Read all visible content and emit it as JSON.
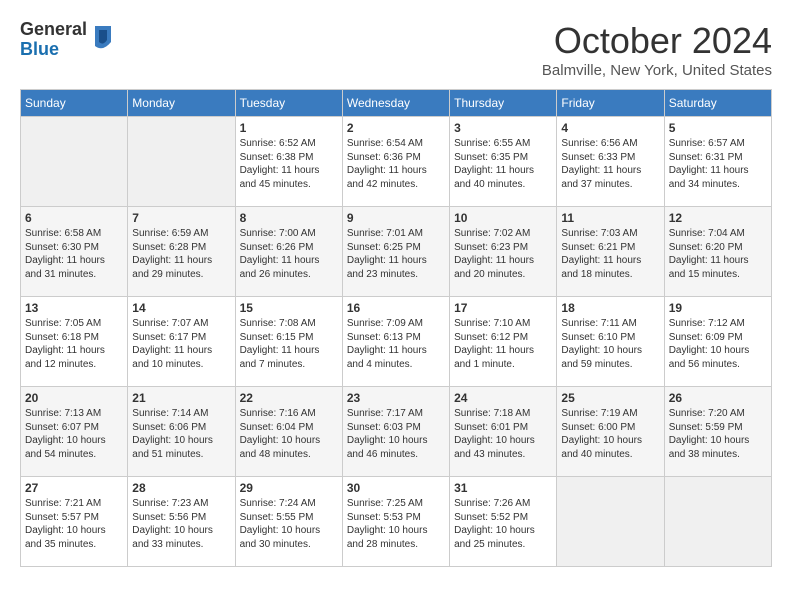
{
  "header": {
    "logo_general": "General",
    "logo_blue": "Blue",
    "month_title": "October 2024",
    "location": "Balmville, New York, United States"
  },
  "days_of_week": [
    "Sunday",
    "Monday",
    "Tuesday",
    "Wednesday",
    "Thursday",
    "Friday",
    "Saturday"
  ],
  "weeks": [
    [
      {
        "day": "",
        "sunrise": "",
        "sunset": "",
        "daylight": ""
      },
      {
        "day": "",
        "sunrise": "",
        "sunset": "",
        "daylight": ""
      },
      {
        "day": "1",
        "sunrise": "Sunrise: 6:52 AM",
        "sunset": "Sunset: 6:38 PM",
        "daylight": "Daylight: 11 hours and 45 minutes."
      },
      {
        "day": "2",
        "sunrise": "Sunrise: 6:54 AM",
        "sunset": "Sunset: 6:36 PM",
        "daylight": "Daylight: 11 hours and 42 minutes."
      },
      {
        "day": "3",
        "sunrise": "Sunrise: 6:55 AM",
        "sunset": "Sunset: 6:35 PM",
        "daylight": "Daylight: 11 hours and 40 minutes."
      },
      {
        "day": "4",
        "sunrise": "Sunrise: 6:56 AM",
        "sunset": "Sunset: 6:33 PM",
        "daylight": "Daylight: 11 hours and 37 minutes."
      },
      {
        "day": "5",
        "sunrise": "Sunrise: 6:57 AM",
        "sunset": "Sunset: 6:31 PM",
        "daylight": "Daylight: 11 hours and 34 minutes."
      }
    ],
    [
      {
        "day": "6",
        "sunrise": "Sunrise: 6:58 AM",
        "sunset": "Sunset: 6:30 PM",
        "daylight": "Daylight: 11 hours and 31 minutes."
      },
      {
        "day": "7",
        "sunrise": "Sunrise: 6:59 AM",
        "sunset": "Sunset: 6:28 PM",
        "daylight": "Daylight: 11 hours and 29 minutes."
      },
      {
        "day": "8",
        "sunrise": "Sunrise: 7:00 AM",
        "sunset": "Sunset: 6:26 PM",
        "daylight": "Daylight: 11 hours and 26 minutes."
      },
      {
        "day": "9",
        "sunrise": "Sunrise: 7:01 AM",
        "sunset": "Sunset: 6:25 PM",
        "daylight": "Daylight: 11 hours and 23 minutes."
      },
      {
        "day": "10",
        "sunrise": "Sunrise: 7:02 AM",
        "sunset": "Sunset: 6:23 PM",
        "daylight": "Daylight: 11 hours and 20 minutes."
      },
      {
        "day": "11",
        "sunrise": "Sunrise: 7:03 AM",
        "sunset": "Sunset: 6:21 PM",
        "daylight": "Daylight: 11 hours and 18 minutes."
      },
      {
        "day": "12",
        "sunrise": "Sunrise: 7:04 AM",
        "sunset": "Sunset: 6:20 PM",
        "daylight": "Daylight: 11 hours and 15 minutes."
      }
    ],
    [
      {
        "day": "13",
        "sunrise": "Sunrise: 7:05 AM",
        "sunset": "Sunset: 6:18 PM",
        "daylight": "Daylight: 11 hours and 12 minutes."
      },
      {
        "day": "14",
        "sunrise": "Sunrise: 7:07 AM",
        "sunset": "Sunset: 6:17 PM",
        "daylight": "Daylight: 11 hours and 10 minutes."
      },
      {
        "day": "15",
        "sunrise": "Sunrise: 7:08 AM",
        "sunset": "Sunset: 6:15 PM",
        "daylight": "Daylight: 11 hours and 7 minutes."
      },
      {
        "day": "16",
        "sunrise": "Sunrise: 7:09 AM",
        "sunset": "Sunset: 6:13 PM",
        "daylight": "Daylight: 11 hours and 4 minutes."
      },
      {
        "day": "17",
        "sunrise": "Sunrise: 7:10 AM",
        "sunset": "Sunset: 6:12 PM",
        "daylight": "Daylight: 11 hours and 1 minute."
      },
      {
        "day": "18",
        "sunrise": "Sunrise: 7:11 AM",
        "sunset": "Sunset: 6:10 PM",
        "daylight": "Daylight: 10 hours and 59 minutes."
      },
      {
        "day": "19",
        "sunrise": "Sunrise: 7:12 AM",
        "sunset": "Sunset: 6:09 PM",
        "daylight": "Daylight: 10 hours and 56 minutes."
      }
    ],
    [
      {
        "day": "20",
        "sunrise": "Sunrise: 7:13 AM",
        "sunset": "Sunset: 6:07 PM",
        "daylight": "Daylight: 10 hours and 54 minutes."
      },
      {
        "day": "21",
        "sunrise": "Sunrise: 7:14 AM",
        "sunset": "Sunset: 6:06 PM",
        "daylight": "Daylight: 10 hours and 51 minutes."
      },
      {
        "day": "22",
        "sunrise": "Sunrise: 7:16 AM",
        "sunset": "Sunset: 6:04 PM",
        "daylight": "Daylight: 10 hours and 48 minutes."
      },
      {
        "day": "23",
        "sunrise": "Sunrise: 7:17 AM",
        "sunset": "Sunset: 6:03 PM",
        "daylight": "Daylight: 10 hours and 46 minutes."
      },
      {
        "day": "24",
        "sunrise": "Sunrise: 7:18 AM",
        "sunset": "Sunset: 6:01 PM",
        "daylight": "Daylight: 10 hours and 43 minutes."
      },
      {
        "day": "25",
        "sunrise": "Sunrise: 7:19 AM",
        "sunset": "Sunset: 6:00 PM",
        "daylight": "Daylight: 10 hours and 40 minutes."
      },
      {
        "day": "26",
        "sunrise": "Sunrise: 7:20 AM",
        "sunset": "Sunset: 5:59 PM",
        "daylight": "Daylight: 10 hours and 38 minutes."
      }
    ],
    [
      {
        "day": "27",
        "sunrise": "Sunrise: 7:21 AM",
        "sunset": "Sunset: 5:57 PM",
        "daylight": "Daylight: 10 hours and 35 minutes."
      },
      {
        "day": "28",
        "sunrise": "Sunrise: 7:23 AM",
        "sunset": "Sunset: 5:56 PM",
        "daylight": "Daylight: 10 hours and 33 minutes."
      },
      {
        "day": "29",
        "sunrise": "Sunrise: 7:24 AM",
        "sunset": "Sunset: 5:55 PM",
        "daylight": "Daylight: 10 hours and 30 minutes."
      },
      {
        "day": "30",
        "sunrise": "Sunrise: 7:25 AM",
        "sunset": "Sunset: 5:53 PM",
        "daylight": "Daylight: 10 hours and 28 minutes."
      },
      {
        "day": "31",
        "sunrise": "Sunrise: 7:26 AM",
        "sunset": "Sunset: 5:52 PM",
        "daylight": "Daylight: 10 hours and 25 minutes."
      },
      {
        "day": "",
        "sunrise": "",
        "sunset": "",
        "daylight": ""
      },
      {
        "day": "",
        "sunrise": "",
        "sunset": "",
        "daylight": ""
      }
    ]
  ]
}
